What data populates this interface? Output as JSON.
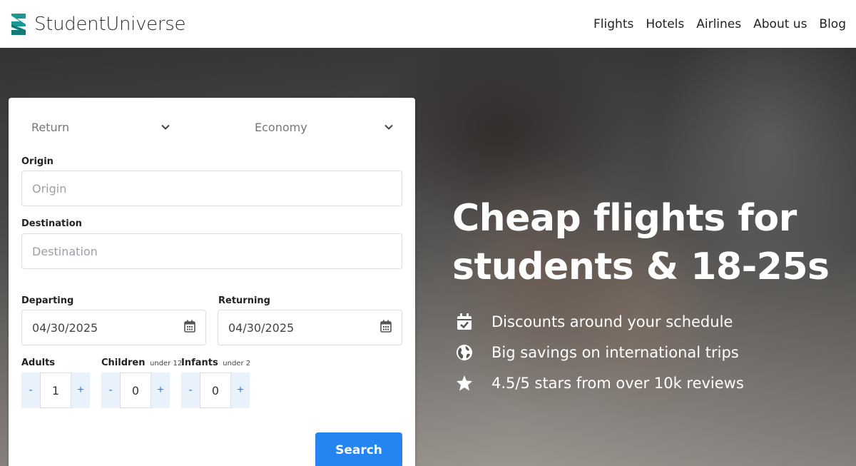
{
  "header": {
    "brand": "StudentUniverse",
    "nav": [
      "Flights",
      "Hotels",
      "Airlines",
      "About us",
      "Blog"
    ]
  },
  "hero": {
    "title": "Cheap flights for students & 18-25s",
    "features": [
      {
        "icon": "calendar-check-icon",
        "text": "Discounts around your schedule"
      },
      {
        "icon": "globe-icon",
        "text": "Big savings on international trips"
      },
      {
        "icon": "star-icon",
        "text": "4.5/5 stars from over 10k reviews"
      }
    ]
  },
  "form": {
    "trip_type": "Return",
    "cabin_class": "Economy",
    "origin_label": "Origin",
    "origin_placeholder": "Origin",
    "destination_label": "Destination",
    "destination_placeholder": "Destination",
    "departing_label": "Departing",
    "departing_value": "04/30/2025",
    "returning_label": "Returning",
    "returning_value": "04/30/2025",
    "adults_label": "Adults",
    "adults_value": "1",
    "children_label": "Children",
    "children_note": "under 12",
    "children_value": "0",
    "infants_label": "Infants",
    "infants_note": "under 2",
    "infants_value": "0",
    "minus": "-",
    "plus": "+",
    "search_label": "Search"
  },
  "colors": {
    "brand_teal": "#1a9a93",
    "primary_button": "#2485f2",
    "stepper_bg": "#e9f1fb"
  }
}
